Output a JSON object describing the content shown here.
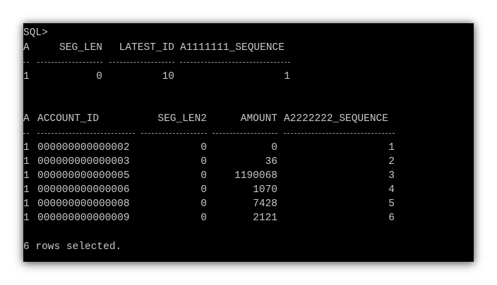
{
  "prompt": "SQL>",
  "table1": {
    "headers": [
      "A",
      "SEG_LEN",
      "LATEST_ID",
      "A1111111_SEQUENCE"
    ],
    "rows": [
      [
        "1",
        "0",
        "10",
        "1"
      ]
    ]
  },
  "table2": {
    "headers": [
      "A",
      "ACCOUNT_ID",
      "SEG_LEN2",
      "AMOUNT",
      "A2222222_SEQUENCE"
    ],
    "rows": [
      [
        "1",
        "000000000000002",
        "0",
        "0",
        "1"
      ],
      [
        "1",
        "000000000000003",
        "0",
        "36",
        "2"
      ],
      [
        "1",
        "000000000000005",
        "0",
        "1190068",
        "3"
      ],
      [
        "1",
        "000000000000006",
        "0",
        "1070",
        "4"
      ],
      [
        "1",
        "000000000000008",
        "0",
        "7428",
        "5"
      ],
      [
        "1",
        "000000000000009",
        "0",
        "2121",
        "6"
      ]
    ]
  },
  "footer": "6 rows selected."
}
